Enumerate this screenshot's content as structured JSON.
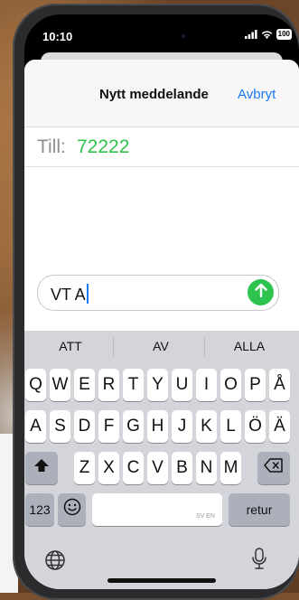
{
  "status_bar": {
    "time": "10:10",
    "battery": "100"
  },
  "sheet": {
    "title": "Nytt meddelande",
    "cancel_label": "Avbryt"
  },
  "recipient": {
    "label": "Till:",
    "value": "72222"
  },
  "compose": {
    "text": "VT A"
  },
  "suggestions": [
    "ATT",
    "AV",
    "ALLA"
  ],
  "keyboard": {
    "row1": [
      "Q",
      "W",
      "E",
      "R",
      "T",
      "Y",
      "U",
      "I",
      "O",
      "P",
      "Å"
    ],
    "row2": [
      "A",
      "S",
      "D",
      "F",
      "G",
      "H",
      "J",
      "K",
      "L",
      "Ö",
      "Ä"
    ],
    "row3": [
      "Z",
      "X",
      "C",
      "V",
      "B",
      "N",
      "M"
    ],
    "numbers_label": "123",
    "space_hint": "SV EN",
    "return_label": "retur"
  },
  "colors": {
    "accent": "#1a7cf5",
    "recipient": "#30c24b",
    "send": "#2ec24f"
  },
  "icons": [
    "signal-icon",
    "wifi-icon",
    "battery-icon",
    "send-arrow-icon",
    "shift-icon",
    "backspace-icon",
    "emoji-icon",
    "globe-icon",
    "mic-icon"
  ]
}
